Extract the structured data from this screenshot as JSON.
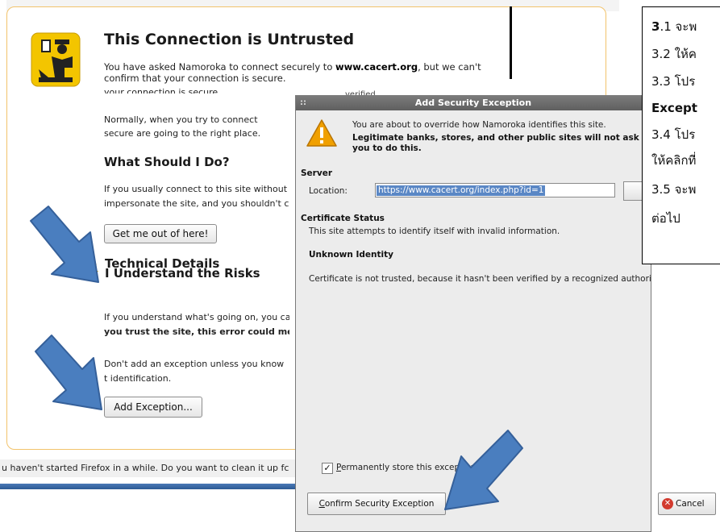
{
  "firefox_page": {
    "title": "This Connection is Untrusted",
    "intro_prefix": "You have asked Namoroka to connect securely to ",
    "intro_site": "www.cacert.org",
    "intro_suffix": ", but we can't confirm that your connection is secure.",
    "intro_repeat": "your connection is secure.",
    "normally_text": "Normally, when you try to connect secure are going to the right place. However, this",
    "verified_fragment": "verified",
    "what_heading": "What Should I Do?",
    "usually_text": "If you usually connect to this site without impersonate the site, and you shouldn't c",
    "get_out_button": "Get me out of here!",
    "technical_heading": "Technical Details",
    "understand_heading": "I Understand the Risks",
    "understand_text": "If you understand what's going on, you ca",
    "understand_bold": "you trust the site, this error could mean",
    "dont_add_text": "Don't add an exception unless you know t identification.",
    "add_exception_button": "Add Exception...",
    "notice_text": "u haven't started Firefox in a while. Do you want to clean it up fc"
  },
  "dialog": {
    "title": "Add Security Exception",
    "grip": "::",
    "override_msg": "You are about to override how Namoroka identifies this site.",
    "legit_msg": "Legitimate banks, stores, and other public sites will not ask you to do this.",
    "server_heading": "Server",
    "location_label": "Location:",
    "location_value": "https://www.cacert.org/index.php?id=1",
    "status_heading": "Certificate Status",
    "status_desc": "This site attempts to identify itself with invalid information.",
    "unknown_heading": "Unknown Identity",
    "not_trusted_text": "Certificate is not trusted, because it hasn't been verified by a recognized authority.",
    "checkbox_checked": true,
    "permanently_label": "Permanently store this exception",
    "confirm_button": "Confirm Security Exception",
    "cancel_button": "Cancel"
  },
  "instructions": {
    "lines": [
      {
        "num": "3",
        "rest": ".1 จะพ"
      },
      {
        "num": "",
        "rest": "3.2 ให้ค"
      },
      {
        "num": "",
        "rest": "3.3 โปร"
      },
      {
        "num": "",
        "rest": "Except"
      },
      {
        "num": "",
        "rest": "3.4 โปร"
      },
      {
        "num": "",
        "rest": "ให้คลิกที่"
      },
      {
        "num": "",
        "rest": "3.5 จะพ"
      },
      {
        "num": "",
        "rest": "ต่อไป"
      }
    ]
  },
  "colors": {
    "arrow_fill": "#4a7ebf",
    "arrow_stroke": "#35609a",
    "warning_yellow": "#f1c40f",
    "expander_orange": "#e3a400"
  }
}
